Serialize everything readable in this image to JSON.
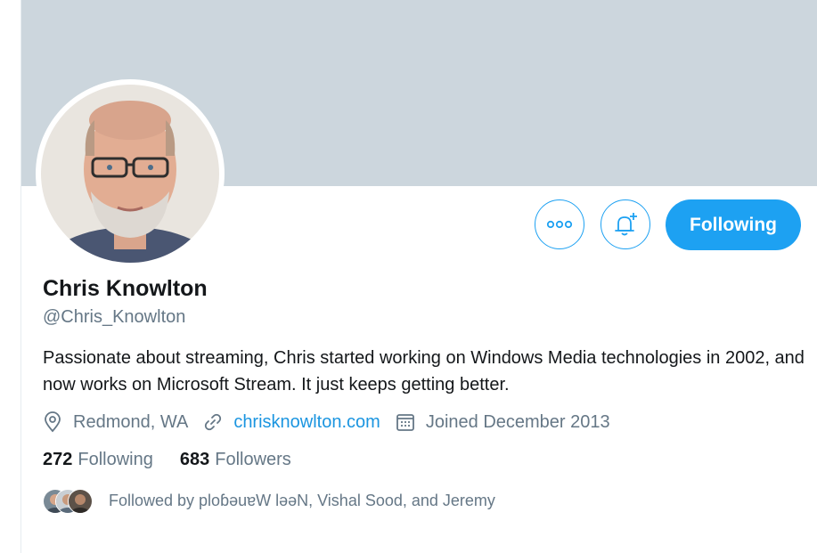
{
  "profile": {
    "name": "Chris Knowlton",
    "handle": "@Chris_Knowlton",
    "bio": "Passionate about streaming, Chris started working on Windows Media technologies in 2002, and now works on Microsoft Stream. It just keeps getting better.",
    "location": "Redmond, WA",
    "website": "chrisknowlton.com",
    "joined": "Joined December 2013"
  },
  "actions": {
    "more_icon": "more-icon",
    "notify_icon": "bell-plus-icon",
    "following_label": "Following"
  },
  "stats": {
    "following_count": "272",
    "following_label": "Following",
    "followers_count": "683",
    "followers_label": "Followers"
  },
  "followed_by": {
    "text": "Followed by ploɓǝuɐW lǝəN, Vishal Sood, and Jeremy"
  },
  "colors": {
    "banner": "#ccd6dd",
    "accent": "#1da1f2",
    "link": "#1b95e0",
    "secondary_text": "#657786",
    "primary_text": "#14171a"
  }
}
